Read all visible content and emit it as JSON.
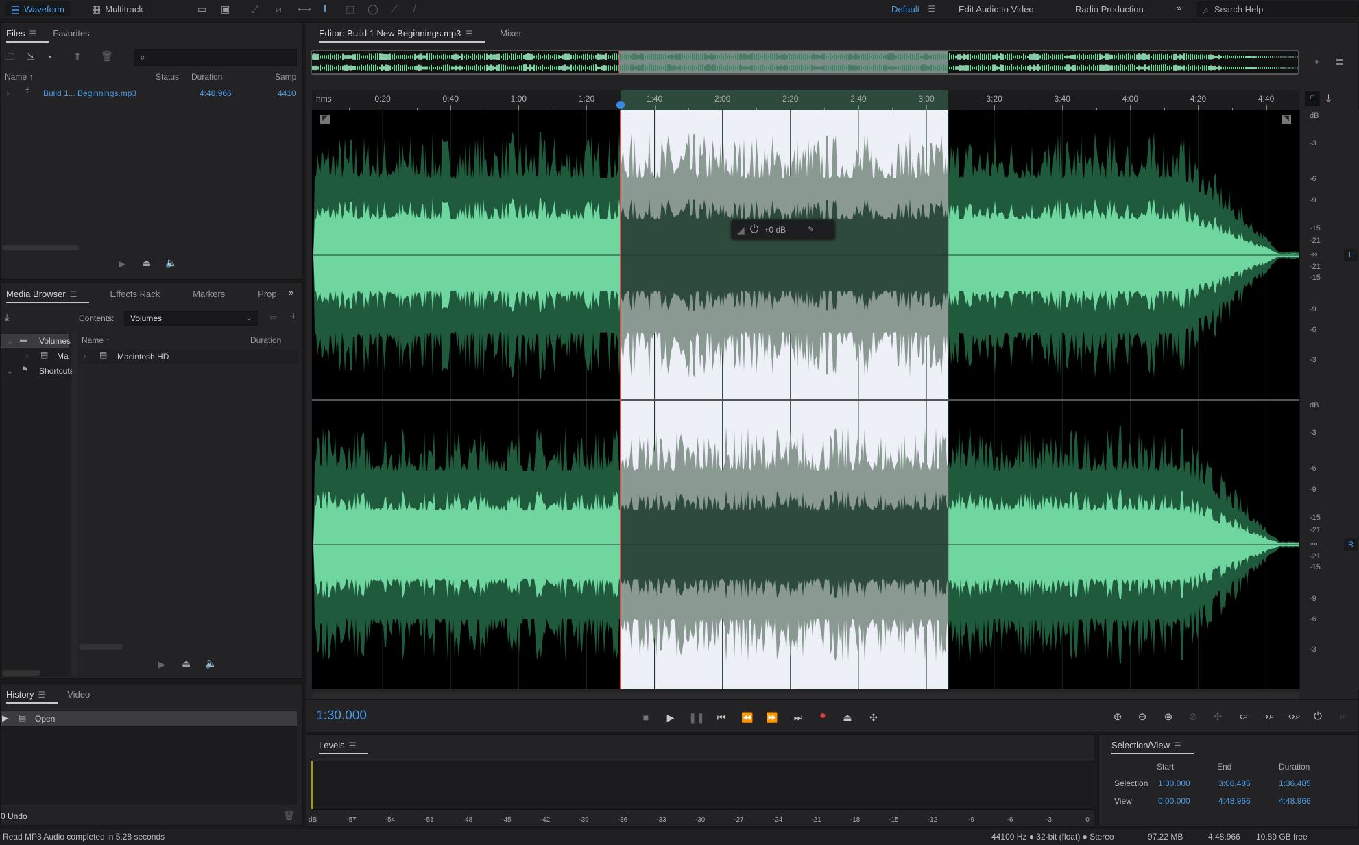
{
  "topbar": {
    "modes": [
      {
        "label": "Waveform",
        "icon": "waveform-icon",
        "active": true
      },
      {
        "label": "Multitrack",
        "icon": "multitrack-icon",
        "active": false
      }
    ],
    "tools": [
      "spectral-frequency-icon",
      "spectral-pitch-icon",
      "move-tool-icon",
      "razor-tool-icon",
      "slip-tool-icon",
      "time-selection-tool-icon",
      "marquee-tool-icon",
      "lasso-tool-icon",
      "brush-tool-icon",
      "spot-healing-icon"
    ],
    "workspaces": [
      {
        "label": "Default",
        "active": true
      },
      {
        "label": "Edit Audio to Video",
        "active": false
      },
      {
        "label": "Radio Production",
        "active": false
      }
    ],
    "more_label": "»",
    "search_placeholder": "Search Help"
  },
  "files_panel": {
    "tabs": [
      "Files",
      "Favorites"
    ],
    "columns": [
      "Name ↑",
      "Status",
      "Duration",
      "Samp"
    ],
    "rows": [
      {
        "name": "Build 1... Beginnings.mp3",
        "status": "",
        "duration": "4:48.966",
        "sample_rate": "4410"
      }
    ]
  },
  "media_browser": {
    "tabs": [
      "Media Browser",
      "Effects Rack",
      "Markers",
      "Prop"
    ],
    "contents_label": "Contents:",
    "contents_value": "Volumes",
    "tree": [
      {
        "label": "Volumes",
        "expanded": true,
        "level": 0,
        "selected": true
      },
      {
        "label": "Ma",
        "expanded": false,
        "level": 1
      },
      {
        "label": "Shortcuts",
        "expanded": true,
        "level": 0
      }
    ],
    "columns": [
      "Name ↑",
      "Duration"
    ],
    "rows": [
      {
        "name": "Macintosh HD",
        "duration": ""
      }
    ]
  },
  "history_panel": {
    "tabs": [
      "History",
      "Video"
    ],
    "items": [
      {
        "label": "Open",
        "selected": true
      }
    ],
    "undo_count": "0 Undo"
  },
  "editor": {
    "tabs": [
      {
        "label": "Editor: Build 1 New Beginnings.mp3",
        "active": true
      },
      {
        "label": "Mixer",
        "active": false
      }
    ],
    "ruler_unit": "hms",
    "ruler_labels": [
      "0:20",
      "0:40",
      "1:00",
      "1:20",
      "1:40",
      "2:00",
      "2:20",
      "2:40",
      "3:00",
      "3:20",
      "3:40",
      "4:00",
      "4:20",
      "4:40"
    ],
    "total_seconds": 288.966,
    "selection_start_seconds": 90.0,
    "selection_end_seconds": 186.485,
    "hud_gain": "+0 dB",
    "db_scale_label": "dB",
    "db_scale_top": [
      "-3",
      "-6",
      "-9",
      "-15",
      "-21",
      "-∞",
      "-21",
      "-15",
      "-9",
      "-6",
      "-3"
    ],
    "channels": [
      "L",
      "R"
    ],
    "current_time": "1:30.000"
  },
  "transport": [
    "stop-icon",
    "play-icon",
    "pause-icon",
    "go-to-start-icon",
    "rewind-icon",
    "fast-forward-icon",
    "go-to-end-icon",
    "record-icon",
    "loop-icon",
    "skip-selection-icon"
  ],
  "zoom_tools": [
    "zoom-in-amplitude-icon",
    "zoom-out-amplitude-icon",
    "zoom-out-full-icon",
    "zoom-in-time-icon",
    "zoom-to-selection-icon",
    "zoom-in-left-icon",
    "zoom-in-right-icon",
    "zoom-selection-icon",
    "reset-zoom-icon",
    "zoom-out-time-icon"
  ],
  "levels": {
    "title": "Levels",
    "scale": [
      "dB",
      "-57",
      "-54",
      "-51",
      "-48",
      "-45",
      "-42",
      "-39",
      "-36",
      "-33",
      "-30",
      "-27",
      "-24",
      "-21",
      "-18",
      "-15",
      "-12",
      "-9",
      "-6",
      "-3",
      "0"
    ]
  },
  "selection_view": {
    "title": "Selection/View",
    "columns": [
      "Start",
      "End",
      "Duration"
    ],
    "rows": [
      {
        "label": "Selection",
        "start": "1:30.000",
        "end": "3:06.485",
        "duration": "1:36.485"
      },
      {
        "label": "View",
        "start": "0:00.000",
        "end": "4:48.966",
        "duration": "4:48.966"
      }
    ]
  },
  "status_bar": {
    "message": "Read MP3 Audio completed in 5.28 seconds",
    "format": "44100 Hz ● 32-bit (float) ● Stereo",
    "file_size": "97.22 MB",
    "duration": "4:48.966",
    "disk_free": "10.89 GB free"
  },
  "colors": {
    "accent": "#4b9be6",
    "waveform": "#6fd6a0",
    "waveform_selected": "#2d4a3c",
    "selection_bg": "#eef0f7",
    "record": "#e04040",
    "playhead": "#e05050"
  }
}
